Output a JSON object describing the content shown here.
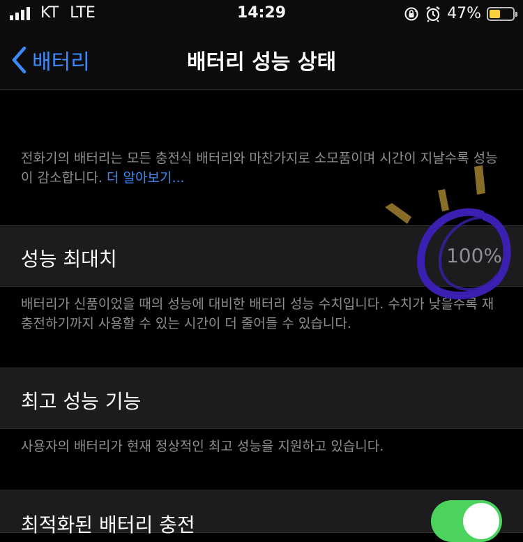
{
  "status_bar": {
    "carrier": "KT",
    "network": "LTE",
    "time": "14:29",
    "battery_percent_label": "47%",
    "battery_level": 0.47,
    "icons": [
      "signal-bars-icon",
      "rotation-lock-icon",
      "alarm-icon",
      "battery-icon"
    ]
  },
  "nav": {
    "back_label": "배터리",
    "title": "배터리 성능 상태"
  },
  "intro": {
    "text": "전화기의 배터리는 모든 충전식 배터리와 마찬가지로 소모품이며 시간이 지날수록 성능이 감소합니다.",
    "link": "더 알아보기..."
  },
  "max_capacity": {
    "label": "성능 최대치",
    "value": "100%",
    "description": "배터리가 신품이었을 때의 성능에 대비한 배터리 성능 수치입니다. 수치가 낮을수록 재충전하기까지 사용할 수 있는 시간이 더 줄어들 수 있습니다."
  },
  "peak_performance": {
    "label": "최고 성능 기능",
    "description": "사용자의 배터리가 현재 정상적인 최고 성능을 지원하고 있습니다."
  },
  "optimized_charging": {
    "label": "최적화된 배터리 충전",
    "enabled": true
  },
  "colors": {
    "accent": "#3e8bf7",
    "toggle_on": "#4bd35e",
    "secondary_text": "#8d8d92",
    "cell_background": "#1c1c1e",
    "annotation_stroke": "#3a1fb0",
    "annotation_marks": "#a08030"
  }
}
